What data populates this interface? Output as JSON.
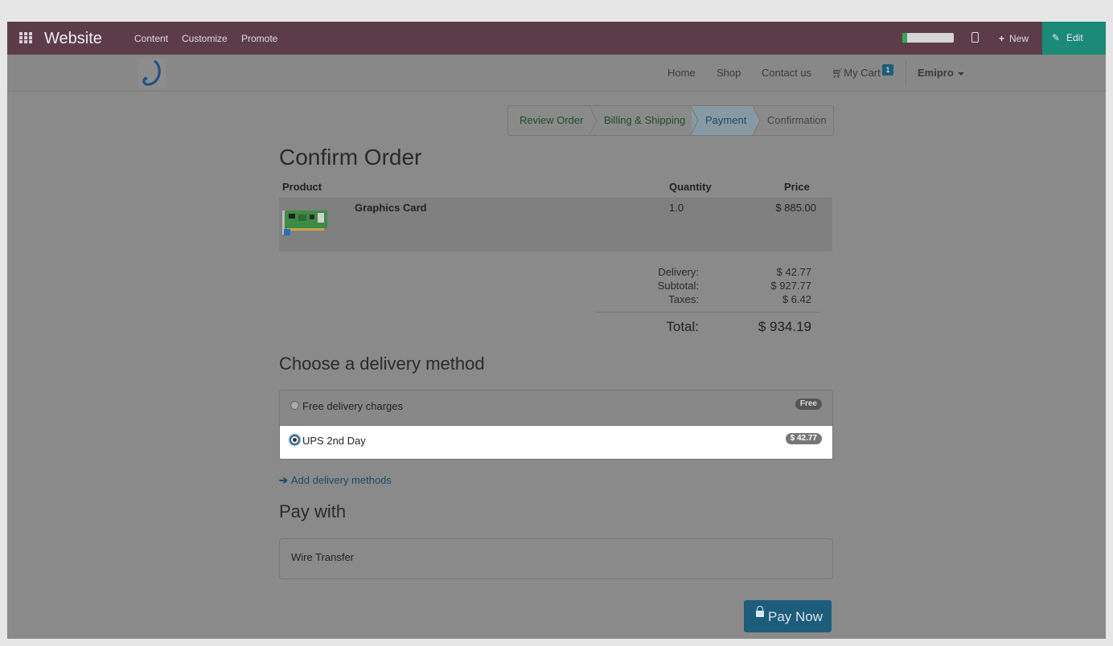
{
  "adminbar": {
    "app_title": "Website",
    "menu": [
      "Content",
      "Customize",
      "Promote"
    ],
    "progress_fraction": 0.1,
    "new_label": "New",
    "edit_label": "Edit",
    "colors": {
      "bar": "#5d3c4a",
      "edit": "#1b8a78"
    }
  },
  "header": {
    "nav": [
      "Home",
      "Shop",
      "Contact us"
    ],
    "cart_label": "My Cart",
    "cart_count": "1",
    "user": "Emipro"
  },
  "wizard": {
    "steps": [
      "Review Order",
      "Billing & Shipping",
      "Payment",
      "Confirmation"
    ],
    "active": "Payment"
  },
  "order": {
    "title": "Confirm Order",
    "columns": {
      "product": "Product",
      "quantity": "Quantity",
      "price": "Price"
    },
    "items": [
      {
        "name": "Graphics Card",
        "quantity": "1.0",
        "price": "$ 885.00"
      }
    ],
    "summary": {
      "delivery_label": "Delivery:",
      "delivery": "$ 42.77",
      "subtotal_label": "Subtotal:",
      "subtotal": "$ 927.77",
      "taxes_label": "Taxes:",
      "taxes": "$ 6.42",
      "total_label": "Total:",
      "total": "$ 934.19"
    }
  },
  "delivery": {
    "title": "Choose a delivery method",
    "methods": [
      {
        "label": "Free delivery charges",
        "badge": "Free",
        "selected": false
      },
      {
        "label": "UPS 2nd Day",
        "badge": "$ 42.77",
        "selected": true
      }
    ],
    "add_link": "Add delivery methods"
  },
  "payment": {
    "title": "Pay with",
    "method": "Wire Transfer",
    "pay_button": "Pay Now"
  }
}
